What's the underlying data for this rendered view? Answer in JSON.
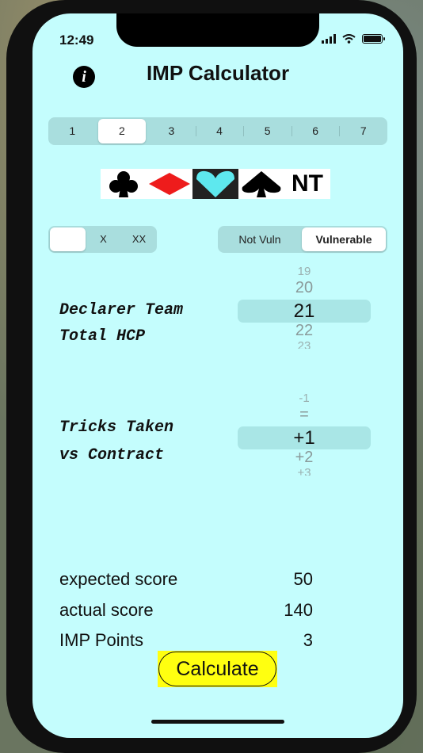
{
  "status": {
    "time": "12:49"
  },
  "header": {
    "title": "IMP Calculator",
    "info_icon": "info-icon"
  },
  "levels": {
    "options": [
      "1",
      "2",
      "3",
      "4",
      "5",
      "6",
      "7"
    ],
    "selected": "2"
  },
  "suits": {
    "options": [
      "clubs",
      "diamonds",
      "hearts",
      "spades",
      "NT"
    ],
    "nt_label": "NT",
    "selected": "hearts",
    "colors": {
      "clubs": "#000000",
      "diamonds": "#ee1c1c",
      "hearts": "#5ee8ee",
      "spades": "#000000"
    }
  },
  "doubling": {
    "options": [
      "",
      "X",
      "XX"
    ],
    "selected": ""
  },
  "vulnerability": {
    "options": [
      "Not Vuln",
      "Vulnerable"
    ],
    "selected": "Vulnerable"
  },
  "hcp": {
    "label": "Declarer Team\nTotal HCP",
    "values": [
      "19",
      "20",
      "21",
      "22",
      "23"
    ],
    "selected": "21"
  },
  "tricks": {
    "label": "Tricks Taken\nvs Contract",
    "values": [
      "-1",
      "=",
      "+1",
      "+2",
      "+3"
    ],
    "selected": "+1"
  },
  "scores": [
    {
      "label": "expected score",
      "value": "50"
    },
    {
      "label": "actual score",
      "value": "140"
    },
    {
      "label": "IMP Points",
      "value": "3"
    }
  ],
  "calculate": {
    "label": "Calculate",
    "color": "#ffff10"
  },
  "theme": {
    "background": "#c4fdfd"
  }
}
